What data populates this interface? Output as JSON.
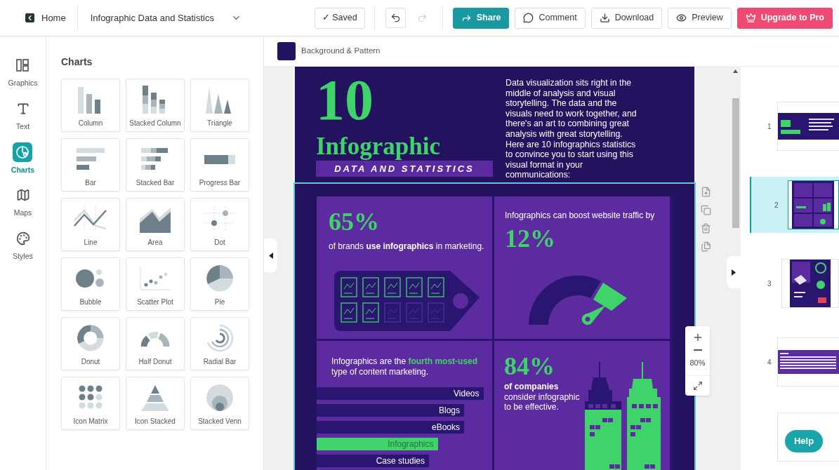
{
  "header": {
    "home": "Home",
    "document_title": "Infographic Data and Statistics",
    "saved": "✓ Saved",
    "redo_disabled": true,
    "buttons": [
      {
        "label": "Share",
        "kind": "share"
      },
      {
        "label": "Comment",
        "kind": "comment"
      },
      {
        "label": "Download",
        "kind": "download"
      },
      {
        "label": "Preview",
        "kind": "preview"
      },
      {
        "label": "Upgrade to Pro",
        "kind": "upgrade"
      }
    ]
  },
  "rail": [
    {
      "label": "Graphics",
      "kind": "graphics",
      "selected": false
    },
    {
      "label": "Text",
      "kind": "text",
      "selected": false
    },
    {
      "label": "Charts",
      "kind": "charts",
      "selected": true
    },
    {
      "label": "Maps",
      "kind": "maps",
      "selected": false
    },
    {
      "label": "Styles",
      "kind": "styles",
      "selected": false
    }
  ],
  "charts_panel": {
    "title": "Charts",
    "items": [
      {
        "label": "Column",
        "kind": "column"
      },
      {
        "label": "Stacked Column",
        "kind": "stacked_column"
      },
      {
        "label": "Triangle",
        "kind": "triangle"
      },
      {
        "label": "Bar",
        "kind": "bar"
      },
      {
        "label": "Stacked Bar",
        "kind": "stacked_bar"
      },
      {
        "label": "Progress Bar",
        "kind": "progress_bar"
      },
      {
        "label": "Line",
        "kind": "line"
      },
      {
        "label": "Area",
        "kind": "area"
      },
      {
        "label": "Dot",
        "kind": "dot"
      },
      {
        "label": "Bubble",
        "kind": "bubble"
      },
      {
        "label": "Scatter Plot",
        "kind": "scatter"
      },
      {
        "label": "Pie",
        "kind": "pie"
      },
      {
        "label": "Donut",
        "kind": "donut"
      },
      {
        "label": "Half Donut",
        "kind": "half_donut"
      },
      {
        "label": "Radial Bar",
        "kind": "radial_bar"
      },
      {
        "label": "Icon Matrix",
        "kind": "icon_matrix"
      },
      {
        "label": "Icon Stacked",
        "kind": "icon_stacked"
      },
      {
        "label": "Stacked Venn",
        "kind": "stacked_venn"
      }
    ]
  },
  "background_bar": {
    "label": "Background & Pattern"
  },
  "infographic": {
    "headline_number": "10",
    "headline_word": "Infographic",
    "banner": "DATA AND STATISTICS",
    "intro": "Data visualization sits right in the middle of analysis and visual storytelling. The data and the visuals need to work together, and there's an art to combining great analysis with great storytelling.",
    "intro_2": "Here are 10 infographics statistics to convince you to start using this visual format in your communications:",
    "section_selected": true,
    "brand_stat": {
      "value": "65%",
      "caption": "of brands **use infographics** in marketing."
    },
    "traffic_stat": {
      "caption": "Infographics can boost website traffic by",
      "value": "12%"
    },
    "content_stat": {
      "before": "Infographics are the ",
      "highlight": "fourth most-used",
      "after": " type of content marketing.",
      "bars": [
        {
          "label": "Videos",
          "level": 0.95,
          "highlighted": false
        },
        {
          "label": "Blogs",
          "level": 0.84,
          "highlighted": false
        },
        {
          "label": "eBooks",
          "level": 0.84,
          "highlighted": false
        },
        {
          "label": "Infographics",
          "level": 0.69,
          "highlighted": true
        },
        {
          "label": "Case studies",
          "level": 0.64,
          "highlighted": false
        }
      ]
    },
    "company_stat": {
      "value": "84%",
      "caption": "**of companies** consider infographic to be effective."
    }
  },
  "zoom": {
    "level_text": "80%"
  },
  "pages": [
    {
      "number": "1",
      "kind": "title",
      "selected": false
    },
    {
      "number": "2",
      "kind": "stats",
      "selected": true
    },
    {
      "number": "3",
      "kind": "map",
      "selected": false
    },
    {
      "number": "4",
      "kind": "text",
      "selected": false
    }
  ],
  "help": "Help"
}
